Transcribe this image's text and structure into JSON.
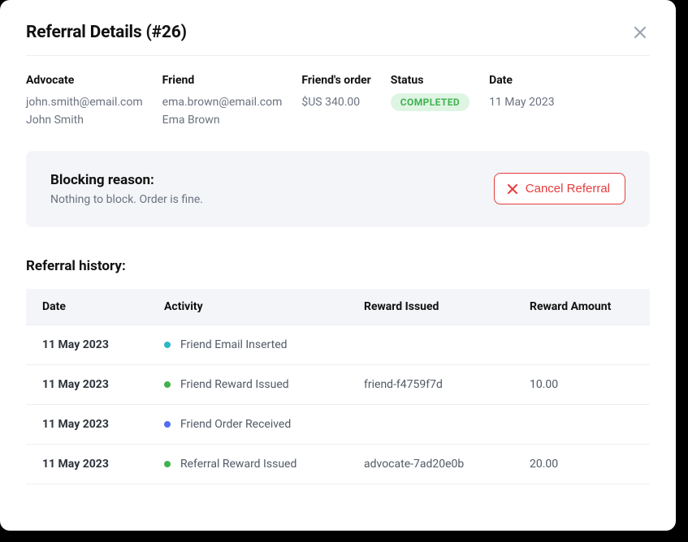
{
  "title": "Referral Details (#26)",
  "summary": {
    "advocate": {
      "label": "Advocate",
      "email": "john.smith@email.com",
      "name": "John Smith"
    },
    "friend": {
      "label": "Friend",
      "email": "ema.brown@email.com",
      "name": "Ema Brown"
    },
    "order": {
      "label": "Friend's order",
      "value": "$US 340.00"
    },
    "status": {
      "label": "Status",
      "badge": "COMPLETED"
    },
    "date": {
      "label": "Date",
      "value": "11 May 2023"
    }
  },
  "blocking": {
    "title": "Blocking reason:",
    "message": "Nothing to block. Order is fine.",
    "cancel_label": "Cancel Referral"
  },
  "history": {
    "title": "Referral history:",
    "columns": [
      "Date",
      "Activity",
      "Reward Issued",
      "Reward Amount"
    ],
    "rows": [
      {
        "date": "11 May 2023",
        "dot": "#2bb8c9",
        "activity": "Friend Email Inserted",
        "reward": "",
        "amount": ""
      },
      {
        "date": "11 May 2023",
        "dot": "#3fb24f",
        "activity": "Friend Reward Issued",
        "reward": "friend-f4759f7d",
        "amount": "10.00"
      },
      {
        "date": "11 May 2023",
        "dot": "#4f6df5",
        "activity": "Friend Order Received",
        "reward": "",
        "amount": ""
      },
      {
        "date": "11 May 2023",
        "dot": "#3fb24f",
        "activity": "Referral Reward Issued",
        "reward": "advocate-7ad20e0b",
        "amount": "20.00"
      }
    ]
  }
}
